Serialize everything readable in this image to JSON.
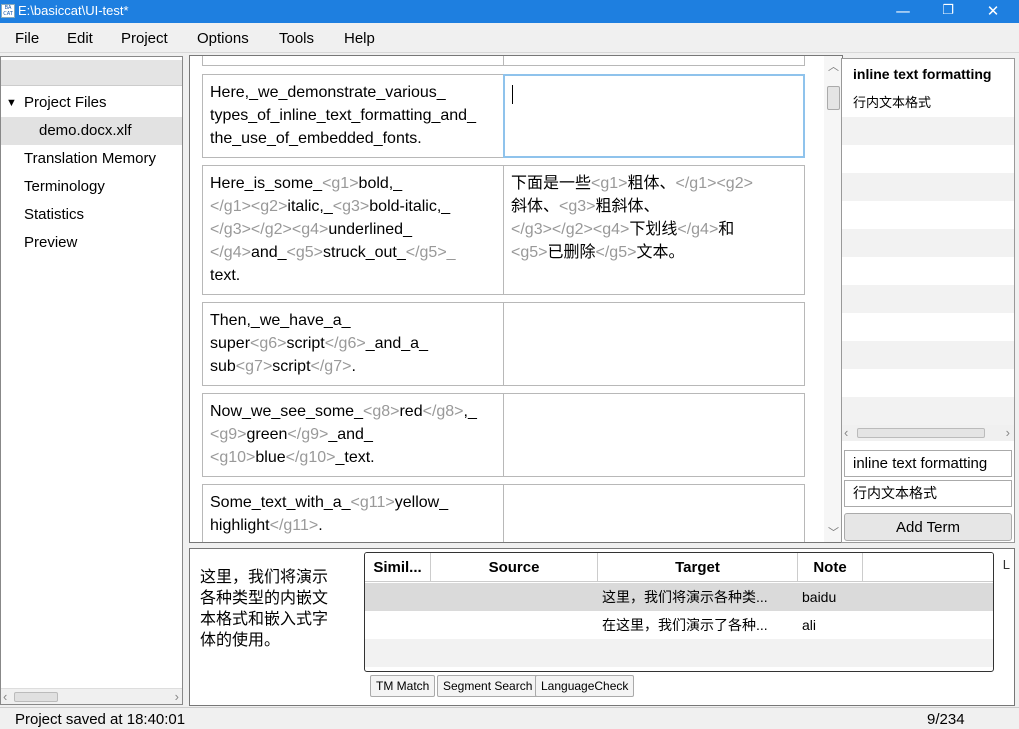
{
  "window": {
    "title": "E:\\basiccat\\UI-test*",
    "icon_text": "BASIC\nCAT"
  },
  "menu": [
    "File",
    "Edit",
    "Project",
    "Options",
    "Tools",
    "Help"
  ],
  "sidebar": {
    "items": [
      {
        "label": "Project Files",
        "expand_glyph": "▼"
      },
      {
        "label": "demo.docx.xlf"
      },
      {
        "label": "Translation Memory"
      },
      {
        "label": "Terminology"
      },
      {
        "label": "Statistics"
      },
      {
        "label": "Preview"
      }
    ]
  },
  "segments": [
    {
      "source_html": "Here,␣we␣demonstrate␣various␣types␣of␣inline␣text␣formatting␣and␣the␣use␣of␣embedded␣fonts.",
      "source": [
        "Here,_we_demonstrate_various_",
        "types_of_inline_text_formatting_and_",
        "the_use_of_embedded_fonts."
      ],
      "target": []
    },
    {
      "source": [
        [
          [
            "t",
            "Here_is_some_"
          ],
          [
            "g",
            "<g1>"
          ],
          [
            "t",
            "bold,_"
          ]
        ],
        [
          [
            "g",
            "</g1><g2>"
          ],
          [
            "t",
            "italic,_"
          ],
          [
            "g",
            "<g3>"
          ],
          [
            "t",
            "bold-italic,_"
          ]
        ],
        [
          [
            "g",
            "</g3></g2><g4>"
          ],
          [
            "t",
            "underlined_"
          ]
        ],
        [
          [
            "g",
            "</g4>"
          ],
          [
            "t",
            "and_"
          ],
          [
            "g",
            "<g5>"
          ],
          [
            "t",
            "struck_out_"
          ],
          [
            "g",
            "</g5>_"
          ]
        ],
        [
          [
            "t",
            "text."
          ]
        ]
      ],
      "target": [
        [
          [
            "t",
            "下面是一些"
          ],
          [
            "g",
            "<g1>"
          ],
          [
            "t",
            "粗体、"
          ],
          [
            "g",
            "</g1><g2>"
          ]
        ],
        [
          [
            "t",
            "斜体、"
          ],
          [
            "g",
            "<g3>"
          ],
          [
            "t",
            "粗斜体、"
          ]
        ],
        [
          [
            "g",
            "</g3></g2><g4>"
          ],
          [
            "t",
            "下划线"
          ],
          [
            "g",
            "</g4>"
          ],
          [
            "t",
            "和"
          ]
        ],
        [
          [
            "g",
            "<g5>"
          ],
          [
            "t",
            "已删除"
          ],
          [
            "g",
            "</g5>"
          ],
          [
            "t",
            "文本。"
          ]
        ]
      ]
    },
    {
      "source": [
        [
          [
            "t",
            "Then,_we_have_a_"
          ]
        ],
        [
          [
            "t",
            "super"
          ],
          [
            "g",
            "<g6>"
          ],
          [
            "t",
            "script"
          ],
          [
            "g",
            "</g6>"
          ],
          [
            "t",
            "_and_a_"
          ]
        ],
        [
          [
            "t",
            "sub"
          ],
          [
            "g",
            "<g7>"
          ],
          [
            "t",
            "script"
          ],
          [
            "g",
            "</g7>"
          ],
          [
            "t",
            "."
          ]
        ]
      ],
      "target": []
    },
    {
      "source": [
        [
          [
            "t",
            "Now_we_see_some_"
          ],
          [
            "g",
            "<g8>"
          ],
          [
            "t",
            "red"
          ],
          [
            "g",
            "</g8>"
          ],
          [
            "t",
            ",_"
          ]
        ],
        [
          [
            "g",
            "<g9>"
          ],
          [
            "t",
            "green"
          ],
          [
            "g",
            "</g9>"
          ],
          [
            "t",
            "_and_"
          ]
        ],
        [
          [
            "g",
            "<g10>"
          ],
          [
            "t",
            "blue"
          ],
          [
            "g",
            "</g10>"
          ],
          [
            "t",
            "_text."
          ]
        ]
      ],
      "target": []
    },
    {
      "source": [
        [
          [
            "t",
            "Some_text_with_a_"
          ],
          [
            "g",
            "<g11>"
          ],
          [
            "t",
            "yellow_"
          ]
        ],
        [
          [
            "t",
            "highlight"
          ],
          [
            "g",
            "</g11>"
          ],
          [
            "t",
            "."
          ]
        ]
      ],
      "target": []
    }
  ],
  "terms": {
    "header_term": "inline text formatting",
    "header_translation": "行内文本格式",
    "term_input": "inline text formatting",
    "translation_input": "行内文本格式",
    "add_button": "Add Term"
  },
  "bottom": {
    "source_preview": "这里，我们将演示各种类型的内嵌文本格式和嵌入式字体的使用。",
    "columns": [
      "Simil...",
      "Source",
      "Target",
      "Note"
    ],
    "rows": [
      {
        "similarity": "",
        "source": "",
        "target": "这里，我们将演示各种类...",
        "note": "baidu"
      },
      {
        "similarity": "",
        "source": "",
        "target": "在这里，我们演示了各种...",
        "note": "ali"
      }
    ],
    "tabs": [
      "TM Match",
      "Segment Search",
      "LanguageCheck"
    ],
    "side_tab": "L"
  },
  "status": {
    "message": "Project saved at 18:40:01",
    "counter": "9/234"
  }
}
